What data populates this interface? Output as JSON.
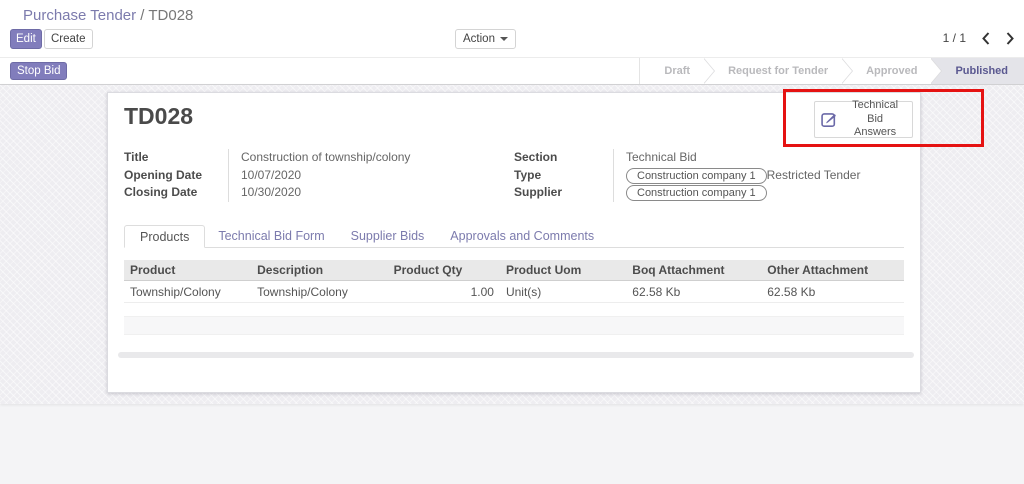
{
  "breadcrumb": {
    "parent": "Purchase Tender",
    "separator": " / ",
    "current": "TD028"
  },
  "control_panel": {
    "edit_label": "Edit",
    "create_label": "Create",
    "action_label": "Action",
    "pager_value": "1 / 1"
  },
  "statusbar": {
    "stop_bid_label": "Stop Bid",
    "steps": [
      {
        "label": "Draft",
        "active": false
      },
      {
        "label": "Request for Tender",
        "active": false
      },
      {
        "label": "Approved",
        "active": false
      },
      {
        "label": "Published",
        "active": true
      }
    ]
  },
  "sheet": {
    "title": "TD028",
    "smart_button": {
      "line1": "Technical Bid",
      "line2": "Answers",
      "icon": "pencil-square-icon"
    },
    "fields_left": [
      {
        "label": "Title",
        "value": "Construction of township/colony"
      },
      {
        "label": "Opening Date",
        "value": "10/07/2020"
      },
      {
        "label": "Closing Date",
        "value": "10/30/2020"
      }
    ],
    "fields_right": [
      {
        "label": "Section",
        "value": "Technical Bid"
      },
      {
        "label": "Type",
        "value": "Restricted Tender"
      },
      {
        "label": "Supplier",
        "value": "Construction company 1"
      }
    ],
    "tabs": [
      {
        "label": "Products",
        "active": true
      },
      {
        "label": "Technical Bid Form",
        "active": false
      },
      {
        "label": "Supplier Bids",
        "active": false
      },
      {
        "label": "Approvals and Comments",
        "active": false
      }
    ],
    "table": {
      "columns": [
        "Product",
        "Description",
        "Product Qty",
        "Product Uom",
        "Boq Attachment",
        "Other Attachment"
      ],
      "rows": [
        [
          "Township/Colony",
          "Township/Colony",
          "1.00",
          "Unit(s)",
          "62.58 Kb",
          "62.58 Kb"
        ]
      ]
    }
  },
  "annotation": {
    "type": "red-highlight-box",
    "target": "technical-bid-answers-button"
  },
  "colors": {
    "accent_purple": "#7c7bad",
    "button_purple": "#817dbc",
    "annotation_red": "#e51212",
    "published_text": "#5a5890",
    "published_bg": "#e4e4e9",
    "table_header_bg": "#e9e9e9"
  }
}
